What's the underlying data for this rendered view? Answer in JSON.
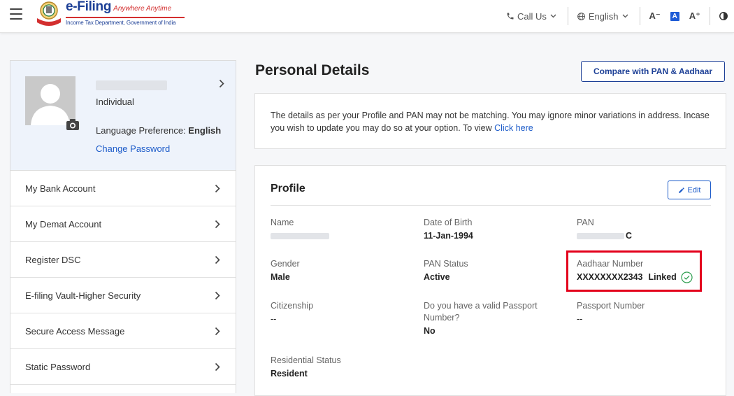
{
  "header": {
    "brand_title": "e-Filing",
    "brand_tagline": "Anywhere Anytime",
    "brand_subtitle": "Income Tax Department, Government of India",
    "call_us": "Call Us",
    "language": "English",
    "font_decrease": "A⁻",
    "font_normal": "A",
    "font_increase": "A⁺"
  },
  "sidebar": {
    "user_type": "Individual",
    "language_label": "Language Preference: ",
    "language_value": "English",
    "change_password": "Change Password",
    "items": [
      {
        "label": "My Bank Account"
      },
      {
        "label": "My Demat Account"
      },
      {
        "label": "Register DSC"
      },
      {
        "label": "E-filing Vault-Higher Security"
      },
      {
        "label": "Secure Access Message"
      },
      {
        "label": "Static Password"
      }
    ]
  },
  "main": {
    "title": "Personal Details",
    "compare_button": "Compare with PAN & Aadhaar",
    "notice_text": "The details as per your Profile and PAN may not be matching. You may ignore minor variations in address. Incase you wish to update you may do so at your option. To view",
    "notice_link": "Click here",
    "profile": {
      "heading": "Profile",
      "edit_button": "Edit",
      "name_label": "Name",
      "dob_label": "Date of Birth",
      "dob_value": "11-Jan-1994",
      "pan_label": "PAN",
      "pan_value_suffix": "C",
      "gender_label": "Gender",
      "gender_value": "Male",
      "pan_status_label": "PAN Status",
      "pan_status_value": "Active",
      "aadhaar_label": "Aadhaar Number",
      "aadhaar_value": "XXXXXXXX2343",
      "aadhaar_status": "Linked",
      "citizenship_label": "Citizenship",
      "citizenship_value": "--",
      "passport_q_label": "Do you have a valid Passport Number?",
      "passport_q_value": "No",
      "passport_no_label": "Passport Number",
      "passport_no_value": "--",
      "residential_label": "Residential Status",
      "residential_value": "Resident"
    }
  },
  "colors": {
    "brand_blue": "#1c3f96",
    "link_blue": "#1c5bc9",
    "highlight_red": "#e3001b",
    "linked_green": "#2e9e4f"
  }
}
